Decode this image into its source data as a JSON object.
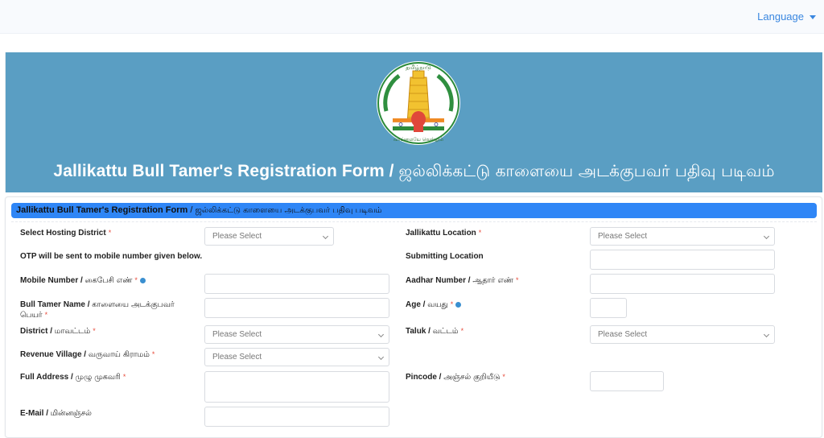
{
  "nav": {
    "language_label": "Language"
  },
  "banner": {
    "emblem_name": "tamil-nadu-emblem",
    "title_en": "Jallikattu Bull Tamer's Registration Form / ",
    "title_ta": "ஜல்லிக்கட்டு காளையை அடக்குபவர் பதிவு படிவம்"
  },
  "section": {
    "title_en": "Jallikattu Bull Tamer's Registration Form",
    "title_sep": " / ",
    "title_ta": "ஜல்லிக்கட்டு காளையை அடக்குபவர் பதிவு படிவம்"
  },
  "colors": {
    "banner_bg": "#5a9ec3",
    "section_bar_bg": "#2f86f6",
    "link": "#3a87e0",
    "required": "#e74c3c"
  },
  "form": {
    "select_placeholder": "Please Select",
    "hosting_district": {
      "label": "Select Hosting District",
      "value": "Please Select"
    },
    "jallikattu_location": {
      "label": "Jallikattu Location",
      "value": "Please Select"
    },
    "otp_note": "OTP will be sent to mobile number given below.",
    "submitting_location": {
      "label": "Submitting Location",
      "value": ""
    },
    "mobile": {
      "label_en": "Mobile Number / ",
      "label_ta": "கைபேசி எண்",
      "value": ""
    },
    "aadhar": {
      "label_en": "Aadhar Number / ",
      "label_ta": "ஆதார் எண்",
      "value": ""
    },
    "tamer_name": {
      "label_en": "Bull Tamer Name / ",
      "label_ta": "காளையை அடக்குபவர் பெயர்",
      "value": ""
    },
    "age": {
      "label_en": "Age / ",
      "label_ta": "வயது",
      "value": ""
    },
    "district": {
      "label_en": "District / ",
      "label_ta": "மாவட்டம்",
      "value": "Please Select"
    },
    "taluk": {
      "label_en": "Taluk / ",
      "label_ta": "வட்டம்",
      "value": "Please Select"
    },
    "revenue_village": {
      "label_en": "Revenue Village / ",
      "label_ta": "வருவாய் கிராமம்",
      "value": "Please Select"
    },
    "full_address": {
      "label_en": "Full Address / ",
      "label_ta": "முழு முகவரி",
      "value": ""
    },
    "pincode": {
      "label_en": "Pincode / ",
      "label_ta": "அஞ்சல் குறியீடு",
      "value": ""
    },
    "email": {
      "label_en": "E-Mail / ",
      "label_ta": "மின்னஞ்சல்",
      "value": ""
    },
    "required_mark": "*"
  }
}
